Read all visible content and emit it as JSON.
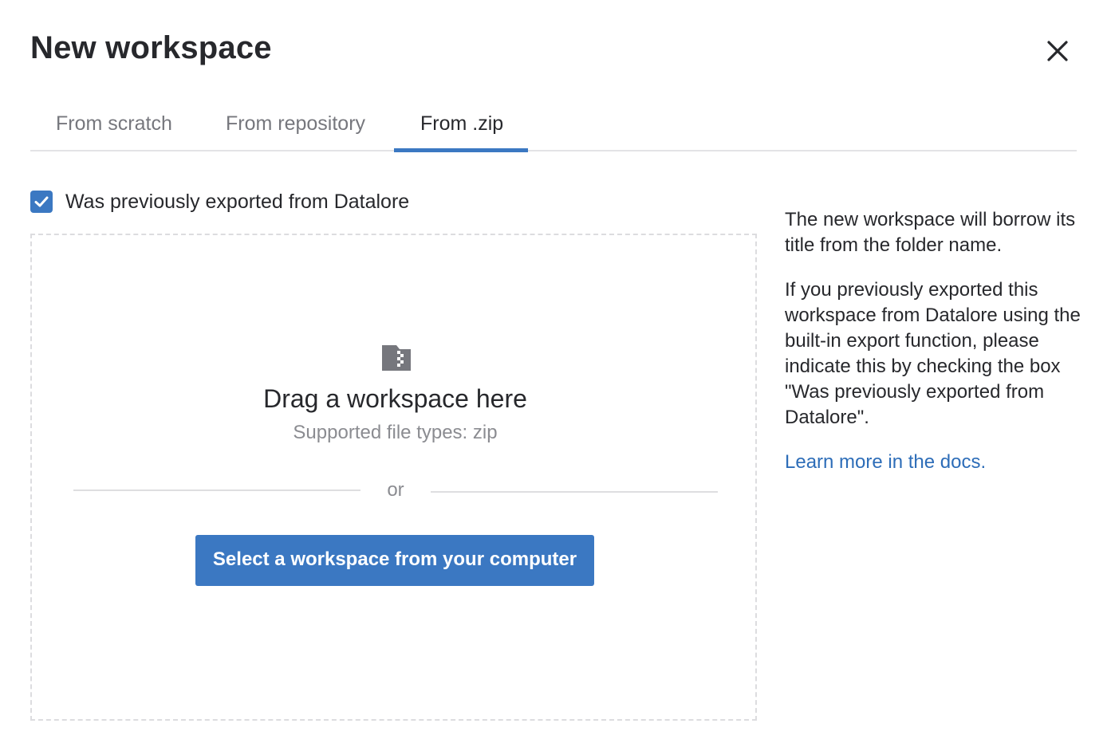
{
  "dialog": {
    "title": "New workspace"
  },
  "tabs": [
    {
      "label": "From scratch",
      "active": false
    },
    {
      "label": "From repository",
      "active": false
    },
    {
      "label": "From .zip",
      "active": true
    }
  ],
  "checkbox": {
    "label": "Was previously exported from Datalore",
    "checked": true
  },
  "dropzone": {
    "icon": "zip-file-icon",
    "title": "Drag a workspace here",
    "supported": "Supported file types: zip",
    "or": "or",
    "button_label": "Select a workspace from your computer"
  },
  "info": {
    "paragraph1": "The new workspace will borrow its title from the folder name.",
    "paragraph2": "If you previously exported this workspace from Datalore using the built-in export function, please indicate this by checking the box \"Was previously exported from Datalore\".",
    "link": "Learn more in the docs."
  },
  "colors": {
    "accent": "#3b78c2",
    "link": "#2d6db8",
    "text": "#27282c",
    "muted": "#76777d"
  }
}
